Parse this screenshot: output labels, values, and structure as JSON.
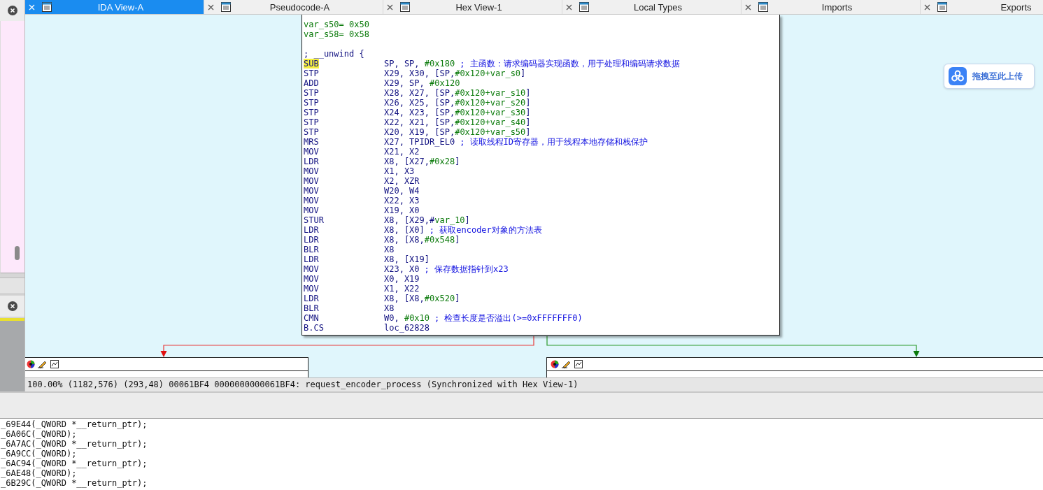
{
  "tabs": [
    {
      "label": "IDA View-A",
      "selected": true
    },
    {
      "label": "Pseudocode-A",
      "selected": false
    },
    {
      "label": "Hex View-1",
      "selected": false
    },
    {
      "label": "Local Types",
      "selected": false
    },
    {
      "label": "Imports",
      "selected": false
    },
    {
      "label": "Exports",
      "selected": false
    }
  ],
  "graph": {
    "lines": [
      {
        "kind": "var",
        "name": "var_s50=",
        "value": "0x50"
      },
      {
        "kind": "var",
        "name": "var_s58=",
        "value": "0x58"
      },
      {
        "kind": "blank"
      },
      {
        "kind": "note",
        "text": "; __unwind {"
      },
      {
        "kind": "ins",
        "op": "SUB",
        "args": [
          {
            "t": "SP, SP, ",
            "kind": "reg"
          },
          {
            "t": "#0x180",
            "kind": "imm"
          }
        ],
        "comment": "; 主函数：请求编码器实现函数，用于处理和编码请求数据",
        "highlighted": true
      },
      {
        "kind": "ins",
        "op": "STP",
        "args": [
          {
            "t": "X29, X30, [SP,",
            "kind": "reg"
          },
          {
            "t": "#0x120+var_s0",
            "kind": "imm"
          },
          {
            "t": "]",
            "kind": "reg"
          }
        ],
        "highlighted": false
      },
      {
        "kind": "ins",
        "op": "ADD",
        "args": [
          {
            "t": "X29, SP, ",
            "kind": "reg"
          },
          {
            "t": "#0x120",
            "kind": "imm"
          }
        ],
        "highlighted": false
      },
      {
        "kind": "ins",
        "op": "STP",
        "args": [
          {
            "t": "X28, X27, [SP,",
            "kind": "reg"
          },
          {
            "t": "#0x120+var_s10",
            "kind": "imm"
          },
          {
            "t": "]",
            "kind": "reg"
          }
        ],
        "highlighted": false
      },
      {
        "kind": "ins",
        "op": "STP",
        "args": [
          {
            "t": "X26, X25, [SP,",
            "kind": "reg"
          },
          {
            "t": "#0x120+var_s20",
            "kind": "imm"
          },
          {
            "t": "]",
            "kind": "reg"
          }
        ],
        "highlighted": false
      },
      {
        "kind": "ins",
        "op": "STP",
        "args": [
          {
            "t": "X24, X23, [SP,",
            "kind": "reg"
          },
          {
            "t": "#0x120+var_s30",
            "kind": "imm"
          },
          {
            "t": "]",
            "kind": "reg"
          }
        ],
        "highlighted": false
      },
      {
        "kind": "ins",
        "op": "STP",
        "args": [
          {
            "t": "X22, X21, [SP,",
            "kind": "reg"
          },
          {
            "t": "#0x120+var_s40",
            "kind": "imm"
          },
          {
            "t": "]",
            "kind": "reg"
          }
        ],
        "highlighted": false
      },
      {
        "kind": "ins",
        "op": "STP",
        "args": [
          {
            "t": "X20, X19, [SP,",
            "kind": "reg"
          },
          {
            "t": "#0x120+var_s50",
            "kind": "imm"
          },
          {
            "t": "]",
            "kind": "reg"
          }
        ],
        "highlighted": false
      },
      {
        "kind": "ins",
        "op": "MRS",
        "args": [
          {
            "t": "X27, TPIDR_EL0",
            "kind": "reg"
          }
        ],
        "comment": "; 读取线程ID寄存器，用于线程本地存储和栈保护",
        "highlighted": false
      },
      {
        "kind": "ins",
        "op": "MOV",
        "args": [
          {
            "t": "X21, X2",
            "kind": "reg"
          }
        ],
        "highlighted": false
      },
      {
        "kind": "ins",
        "op": "LDR",
        "args": [
          {
            "t": "X8, [X27,",
            "kind": "reg"
          },
          {
            "t": "#0x28",
            "kind": "imm"
          },
          {
            "t": "]",
            "kind": "reg"
          }
        ],
        "highlighted": false
      },
      {
        "kind": "ins",
        "op": "MOV",
        "args": [
          {
            "t": "X1, X3",
            "kind": "reg"
          }
        ],
        "highlighted": false
      },
      {
        "kind": "ins",
        "op": "MOV",
        "args": [
          {
            "t": "X2, XZR",
            "kind": "reg"
          }
        ],
        "highlighted": false
      },
      {
        "kind": "ins",
        "op": "MOV",
        "args": [
          {
            "t": "W20, W4",
            "kind": "reg"
          }
        ],
        "highlighted": false
      },
      {
        "kind": "ins",
        "op": "MOV",
        "args": [
          {
            "t": "X22, X3",
            "kind": "reg"
          }
        ],
        "highlighted": false
      },
      {
        "kind": "ins",
        "op": "MOV",
        "args": [
          {
            "t": "X19, X0",
            "kind": "reg"
          }
        ],
        "highlighted": false
      },
      {
        "kind": "ins",
        "op": "STUR",
        "args": [
          {
            "t": "X8, [X29,#",
            "kind": "reg"
          },
          {
            "t": "var_10",
            "kind": "imm"
          },
          {
            "t": "]",
            "kind": "reg"
          }
        ],
        "highlighted": false
      },
      {
        "kind": "ins",
        "op": "LDR",
        "args": [
          {
            "t": "X8, [X0]",
            "kind": "reg"
          }
        ],
        "comment": "; 获取encoder对象的方法表",
        "highlighted": false
      },
      {
        "kind": "ins",
        "op": "LDR",
        "args": [
          {
            "t": "X8, [X8,",
            "kind": "reg"
          },
          {
            "t": "#0x548",
            "kind": "imm"
          },
          {
            "t": "]",
            "kind": "reg"
          }
        ],
        "highlighted": false
      },
      {
        "kind": "ins",
        "op": "BLR",
        "args": [
          {
            "t": "X8",
            "kind": "reg"
          }
        ],
        "highlighted": false
      },
      {
        "kind": "ins",
        "op": "LDR",
        "args": [
          {
            "t": "X8, [X19]",
            "kind": "reg"
          }
        ],
        "highlighted": false
      },
      {
        "kind": "ins",
        "op": "MOV",
        "args": [
          {
            "t": "X23, X0",
            "kind": "reg"
          }
        ],
        "comment": "; 保存数据指针到x23",
        "highlighted": false
      },
      {
        "kind": "ins",
        "op": "MOV",
        "args": [
          {
            "t": "X0, X19",
            "kind": "reg"
          }
        ],
        "highlighted": false
      },
      {
        "kind": "ins",
        "op": "MOV",
        "args": [
          {
            "t": "X1, X22",
            "kind": "reg"
          }
        ],
        "highlighted": false
      },
      {
        "kind": "ins",
        "op": "LDR",
        "args": [
          {
            "t": "X8, [X8,",
            "kind": "reg"
          },
          {
            "t": "#0x520",
            "kind": "imm"
          },
          {
            "t": "]",
            "kind": "reg"
          }
        ],
        "highlighted": false
      },
      {
        "kind": "ins",
        "op": "BLR",
        "args": [
          {
            "t": "X8",
            "kind": "reg"
          }
        ],
        "highlighted": false
      },
      {
        "kind": "ins",
        "op": "CMN",
        "args": [
          {
            "t": "W0, ",
            "kind": "reg"
          },
          {
            "t": "#0x10",
            "kind": "imm"
          }
        ],
        "comment": "; 检查长度是否溢出(>=0xFFFFFFF0)",
        "highlighted": false
      },
      {
        "kind": "ins",
        "op": "B.CS",
        "args": [
          {
            "t": "loc_62828",
            "kind": "reg"
          }
        ],
        "highlighted": false
      }
    ]
  },
  "upload_button": {
    "label": "拖拽至此上传"
  },
  "status_bar": {
    "text": "100.00% (1182,576) (293,48) 00061BF4 0000000000061BF4: request_encoder_process (Synchronized with Hex View-1)"
  },
  "output_lines": [
    "_69E44(_QWORD *__return_ptr);",
    "_6A06C(_QWORD);",
    "_6A7AC(_QWORD *__return_ptr);",
    "_6A9CC(_QWORD);",
    "_6AC94(_QWORD *__return_ptr);",
    "_6AE48(_QWORD);",
    "_6B29C(_QWORD *__return_ptr);"
  ]
}
